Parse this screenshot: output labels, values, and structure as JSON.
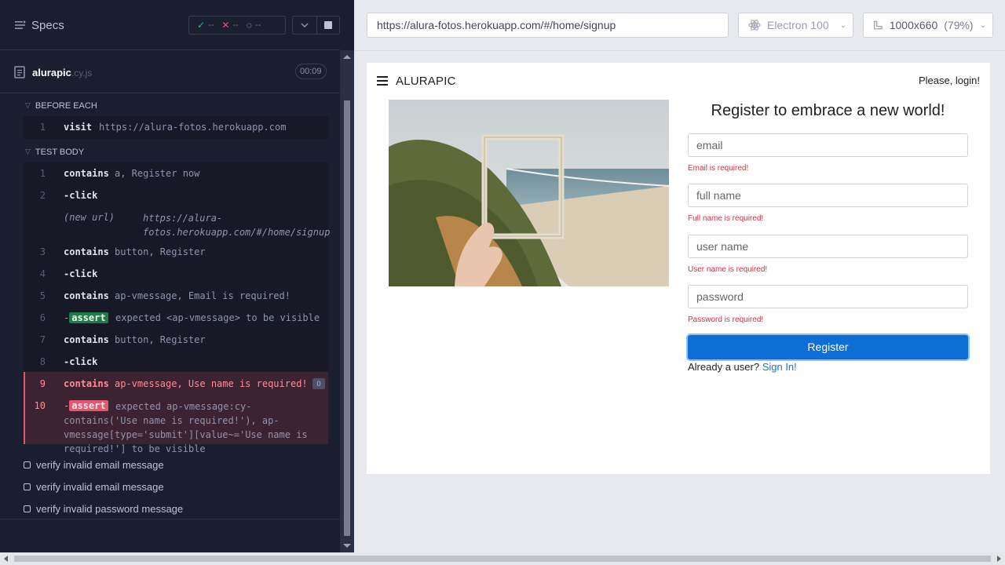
{
  "reporter": {
    "specs_title": "Specs",
    "stats": {
      "passed": "--",
      "failed": "--",
      "pending": "--"
    },
    "file": {
      "name": "alurapic",
      "ext": ".cy.js",
      "timer": "00:09"
    },
    "before_each": {
      "heading": "BEFORE EACH",
      "commands": [
        {
          "num": "1",
          "name": "visit",
          "msg": "https://alura-fotos.herokuapp.com"
        }
      ]
    },
    "test_body": {
      "heading": "TEST BODY",
      "commands": [
        {
          "num": "1",
          "name": "contains",
          "msg": "a, Register now"
        },
        {
          "num": "2",
          "name": "-click",
          "msg": ""
        },
        {
          "num": "",
          "name": "(new url)",
          "msg": "https://alura-fotos.herokuapp.com/#/home/signup"
        },
        {
          "num": "3",
          "name": "contains",
          "msg": "button, Register"
        },
        {
          "num": "4",
          "name": "-click",
          "msg": ""
        },
        {
          "num": "5",
          "name": "contains",
          "msg": "ap-vmessage, Email is required!"
        },
        {
          "num": "6",
          "name": "assert",
          "msg": "expected <ap-vmessage> to be visible"
        },
        {
          "num": "7",
          "name": "contains",
          "msg": "button, Register"
        },
        {
          "num": "8",
          "name": "-click",
          "msg": ""
        },
        {
          "num": "9",
          "name": "contains",
          "msg": "ap-vmessage, Use name is required!"
        },
        {
          "num": "10",
          "name": "assert",
          "msg": "expected ap-vmessage:cy-contains('Use name is required!'), ap-vmessage[type='submit'][value~='Use name is required!'] to be visible"
        }
      ],
      "pin_badge": "0"
    },
    "tests": [
      {
        "title": "verify invalid email message"
      },
      {
        "title": "verify invalid email message"
      },
      {
        "title": "verify invalid password message"
      }
    ]
  },
  "aut": {
    "url": "https://alura-fotos.herokuapp.com/#/home/signup",
    "browser": "Electron 100",
    "viewport": "1000x660",
    "zoom": "(79%)",
    "app": {
      "brand": "ALURAPIC",
      "please_login": "Please, login!",
      "form_title": "Register to embrace a new world!",
      "fields": [
        {
          "placeholder": "email",
          "error": "Email is required!"
        },
        {
          "placeholder": "full name",
          "error": "Full name is required!"
        },
        {
          "placeholder": "user name",
          "error": "User name is required!"
        },
        {
          "placeholder": "password",
          "error": "Password is required!"
        }
      ],
      "register_label": "Register",
      "already_text": "Already a user?",
      "sign_in_label": "Sign In!"
    }
  },
  "colors": {
    "accent": "#0d6ed6",
    "error": "#d0313f",
    "passed": "#1f7a4c",
    "failed": "#e45770"
  }
}
